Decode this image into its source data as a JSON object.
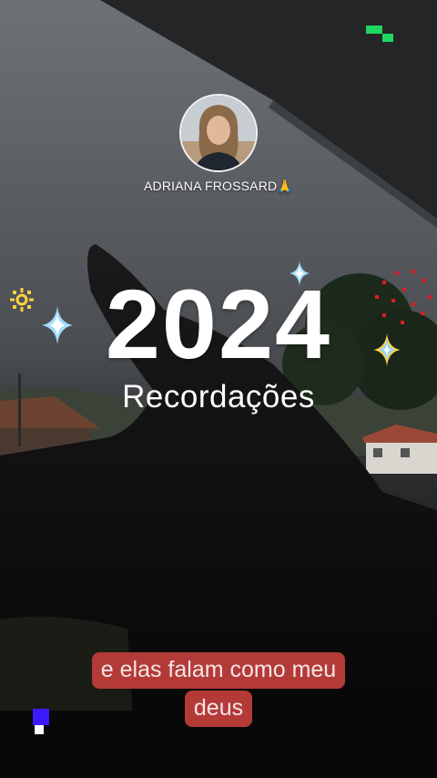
{
  "profile": {
    "name": "ADRIANA FROSSARD",
    "name_emoji": "🙏"
  },
  "title": {
    "year": "2024",
    "subtitle": "Recordações"
  },
  "caption": {
    "line1": "e elas falam como meu",
    "line2": "deus"
  },
  "colors": {
    "caption_bg": "#b43a38",
    "text": "#ffffff",
    "sparkle_blue": "#8fd3ff",
    "sparkle_yellow": "#ffd23f",
    "firework_red": "#e11b22",
    "corner_green": "#1ed760",
    "corner_blue": "#3b19ff"
  },
  "icons": [
    "sparkle-icon",
    "sun-sticker-icon",
    "firework-sticker-icon",
    "green-corner-marker-icon",
    "blue-corner-marker-icon"
  ]
}
